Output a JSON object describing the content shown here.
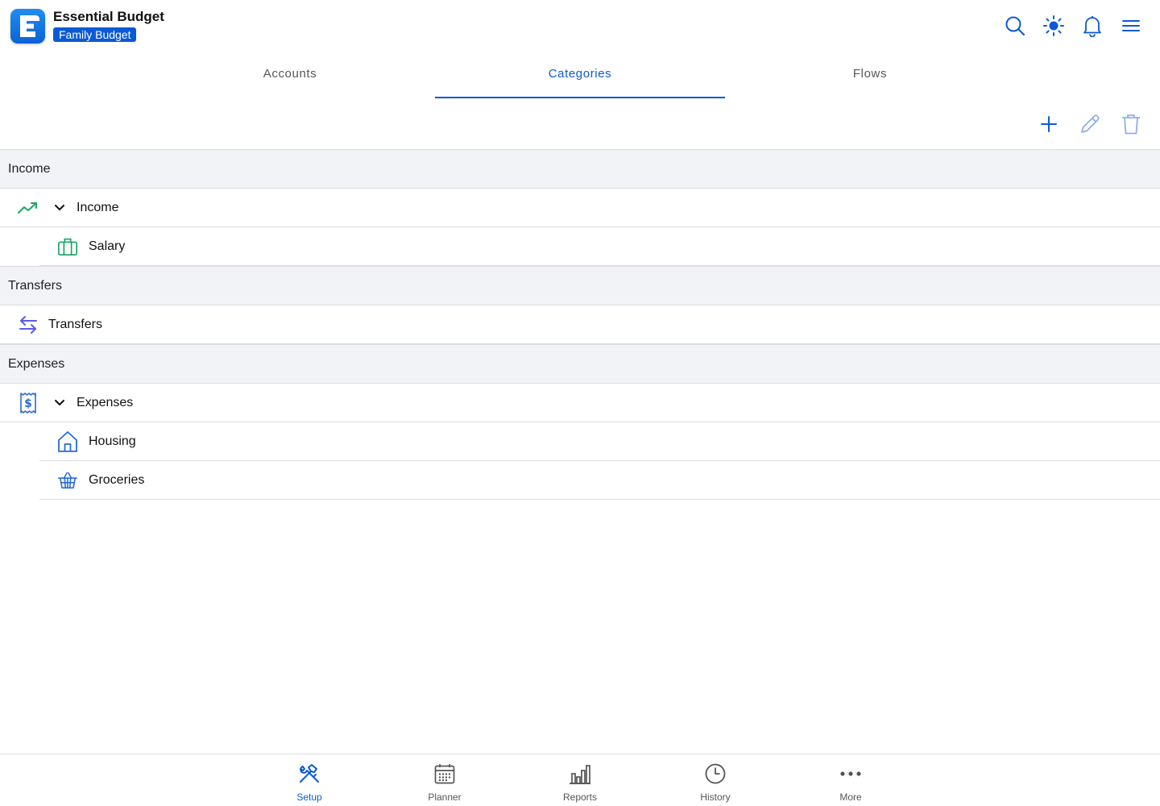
{
  "app": {
    "title": "Essential Budget",
    "budget_name": "Family Budget",
    "accent_color": "#0a5ad6"
  },
  "header_icons": [
    "search-icon",
    "brightness-icon",
    "bell-icon",
    "menu-icon"
  ],
  "tabs": [
    {
      "label": "Accounts",
      "active": false
    },
    {
      "label": "Categories",
      "active": true
    },
    {
      "label": "Flows",
      "active": false
    }
  ],
  "toolbar": {
    "add": "plus-icon",
    "edit": "pencil-icon",
    "delete": "trash-icon"
  },
  "sections": [
    {
      "title": "Income",
      "items": [
        {
          "label": "Income",
          "icon": "trending-up-icon",
          "expanded": true,
          "icon_color": "#1aa56a"
        },
        {
          "label": "Salary",
          "icon": "briefcase-icon",
          "child": true,
          "icon_color": "#1aa56a"
        }
      ]
    },
    {
      "title": "Transfers",
      "items": [
        {
          "label": "Transfers",
          "icon": "transfer-arrows-icon",
          "icon_color": "#5a5ae8"
        }
      ]
    },
    {
      "title": "Expenses",
      "items": [
        {
          "label": "Expenses",
          "icon": "receipt-icon",
          "expanded": true,
          "icon_color": "#2a6ad8"
        },
        {
          "label": "Housing",
          "icon": "house-icon",
          "child": true,
          "icon_color": "#2a6ad8"
        },
        {
          "label": "Groceries",
          "icon": "basket-icon",
          "child": true,
          "icon_color": "#2a6ad8"
        }
      ]
    }
  ],
  "bottom_nav": [
    {
      "label": "Setup",
      "icon": "tools-icon",
      "active": true
    },
    {
      "label": "Planner",
      "icon": "calendar-icon",
      "active": false
    },
    {
      "label": "Reports",
      "icon": "bar-chart-icon",
      "active": false
    },
    {
      "label": "History",
      "icon": "clock-icon",
      "active": false
    },
    {
      "label": "More",
      "icon": "more-dots-icon",
      "active": false
    }
  ]
}
